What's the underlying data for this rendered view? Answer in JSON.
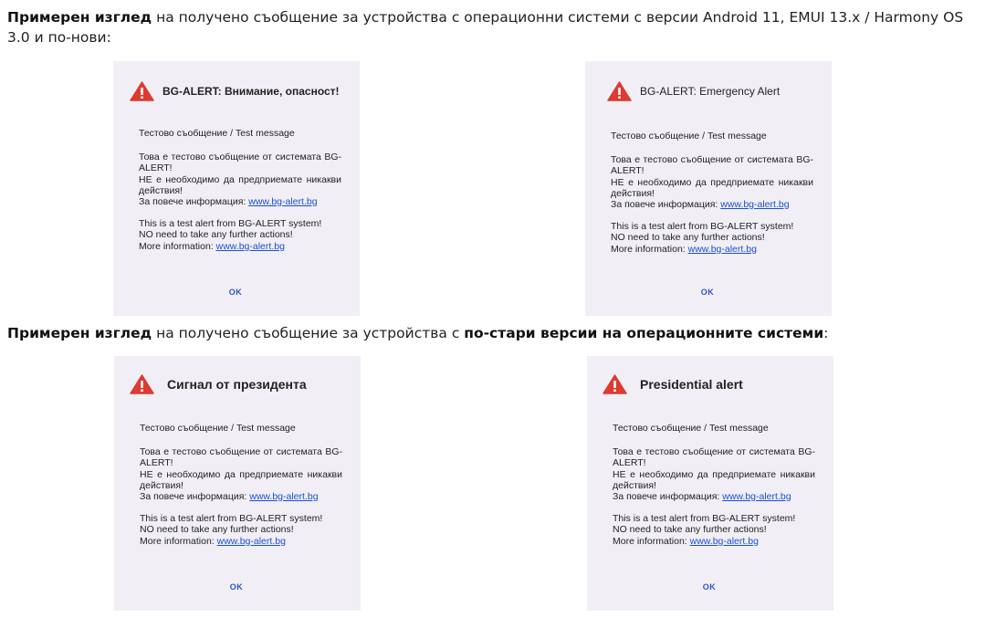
{
  "intro_new": {
    "bold": "Примерен изглед",
    "rest": " на получено съобщение за устройства с операционни системи с версии Android 11, EMUI 13.x / Harmony OS 3.0 и по-нови:"
  },
  "intro_old": {
    "bold1": "Примерен изглед",
    "mid": " на получено съобщение за устройства с ",
    "bold2": "по-стари версии на операционните системи",
    "end": ":"
  },
  "cards": [
    {
      "title": "BG-ALERT: Внимание, опасност!"
    },
    {
      "title": "BG-ALERT: Emergency Alert"
    },
    {
      "title": "Сигнал от президента"
    },
    {
      "title": "Presidential alert"
    }
  ],
  "message": {
    "subject": "Тестово съобщение / Test message",
    "bg_line1": "Това е тестово съобщение от системата BG-ALERT!",
    "bg_line2": "НЕ е необходимо да предприемате никакви действия!",
    "bg_more_label": "За повече информация: ",
    "link": "www.bg-alert.bg",
    "en_line1": "This is a test alert from BG-ALERT system!",
    "en_line2": "NO need to take any further actions!",
    "en_more_label": "More information: ",
    "ok": "OK"
  },
  "colors": {
    "warning_triangle": "#dc3a32",
    "link": "#1a4fd6",
    "card_bg": "#f1eff5"
  }
}
